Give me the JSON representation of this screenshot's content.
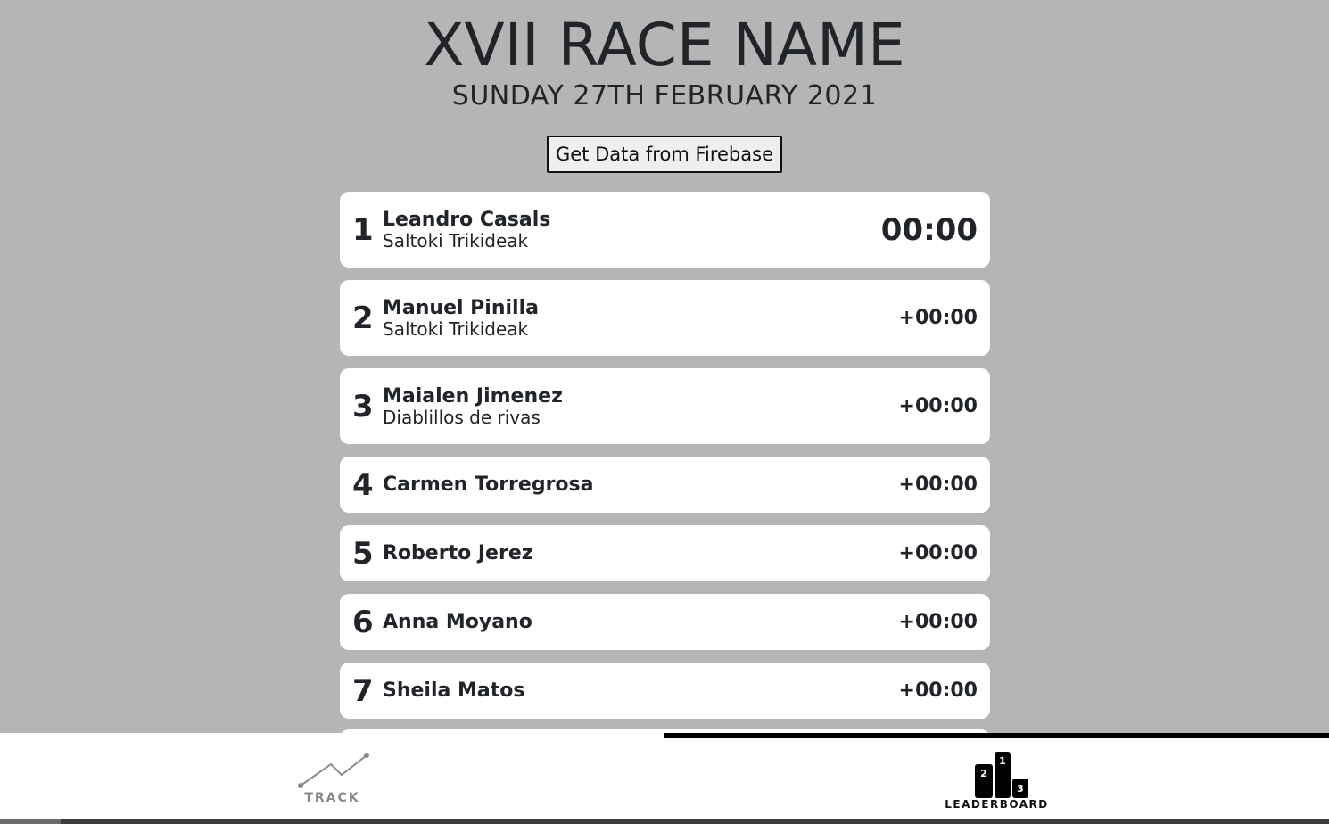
{
  "header": {
    "title": "XVII RACE NAME",
    "date": "SUNDAY 27TH FEBRUARY 2021"
  },
  "toolbar": {
    "firebase_button_label": "Get Data from Firebase"
  },
  "leaderboard": {
    "rows": [
      {
        "position": "1",
        "name": "Leandro Casals",
        "team": "Saltoki Trikideak",
        "time": "00:00"
      },
      {
        "position": "2",
        "name": "Manuel Pinilla",
        "team": "Saltoki Trikideak",
        "time": "+00:00"
      },
      {
        "position": "3",
        "name": "Maialen Jimenez",
        "team": "Diablillos de rivas",
        "time": "+00:00"
      },
      {
        "position": "4",
        "name": "Carmen Torregrosa",
        "team": "",
        "time": "+00:00"
      },
      {
        "position": "5",
        "name": "Roberto Jerez",
        "team": "",
        "time": "+00:00"
      },
      {
        "position": "6",
        "name": "Anna Moyano",
        "team": "",
        "time": "+00:00"
      },
      {
        "position": "7",
        "name": "Sheila Matos",
        "team": "",
        "time": "+00:00"
      }
    ]
  },
  "nav": {
    "track_label": "TRACK",
    "track_icon": "track-line-icon",
    "leaderboard_label": "LEADERBOARD",
    "leaderboard_icon": "podium-icon",
    "podium_numbers": [
      "2",
      "1",
      "3"
    ],
    "active_tab": "leaderboard"
  }
}
